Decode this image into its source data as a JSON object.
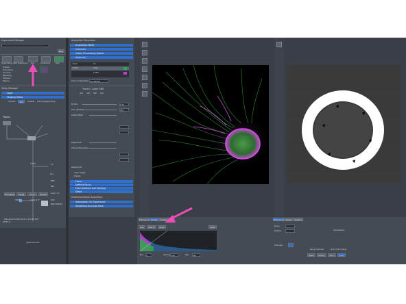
{
  "left_panel": {
    "experiment_manager": "Experiment Manager",
    "new_button": "New",
    "mode_tabs": [
      "Smart Setup",
      "Start Experiment",
      "Live",
      "Continuous",
      "Stop"
    ],
    "options": [
      "Z-Stack",
      "Time Series",
      "Tile Scan",
      "Bleaching",
      "Positions",
      "Regions"
    ],
    "setup_manager": "Setup Manager",
    "laser": "Laser",
    "imaging_setup": "Imaging Setup",
    "track_label": "Track1",
    "mode_options": [
      "Channel",
      "Fast",
      "Lambda",
      "Online Fingerprinting"
    ],
    "lightpath_labels": [
      "T PMT",
      "T1",
      "Ch1",
      "MBS",
      "488",
      "Lens 1.4x",
      "TPMT",
      "ChD",
      "MBS 488/561",
      "Angle 0.0°",
      "Plan-Apochromat 63x/1.4 Oil DIC M27",
      "Aperture 0 Ch1"
    ],
    "lightpath_buttons": [
      "Emulation",
      "Stage",
      "Fluor",
      "Transm"
    ],
    "bottom_label": "Off 25 %"
  },
  "acq_panel": {
    "title": "Acquisition Parameter",
    "sections": [
      "Acquisition Mode",
      "Channels",
      "Online Processing Options",
      "Channels"
    ],
    "track_table_headers": [
      "Track",
      "Ch"
    ],
    "track_rows": [
      "Track1",
      "ChS1",
      "T PMT"
    ],
    "track_config": "Track Configuration",
    "track_config_value": "not defined",
    "laser_title": "Track1 / Laser 488",
    "laser_lines": [
      "405",
      "458",
      "488",
      "514"
    ],
    "rows": [
      "Pinhole",
      "Gain (Master)",
      "Digital Offset",
      "Digital Gain",
      "Channel Resolution",
      "Wavelength"
    ],
    "value_a": "1.25",
    "value_b": "750",
    "bottom_sections": [
      "Focus",
      "Definite Focus",
      "Focus Devices and Strategy",
      "Stage",
      "Multidimensional Acquisition",
      "Information On Experiment",
      "Streaming and Auto Save"
    ],
    "checkbox_items": [
      "Laser Trigger",
      "Display"
    ]
  },
  "viewer": {
    "bottom_tabs": [
      "Dimensions",
      "Display",
      "Graphics"
    ],
    "histogram_labels": [
      "Auto",
      "Best Fit",
      "Reset"
    ],
    "min_label": "Min",
    "min_value": "0",
    "gamma_label": "Gamma",
    "gamma_value": "1.00",
    "max_label": "Max",
    "max_value": "255",
    "reset_label": "Reset"
  },
  "right_panel": {
    "tabs": [
      "Dimensions",
      "Display",
      "Graphics"
    ],
    "controls": [
      "Zoom",
      "Position",
      "Channels",
      "Interpolation"
    ],
    "buttons": [
      "Range Indicator",
      "Quick Color Setup",
      "Reset",
      "Extract",
      "Mono",
      "Color"
    ]
  },
  "colors": {
    "panel": "#454b54",
    "accent_blue": "#2f6fd0",
    "annotation_arrow": "#e94fb6",
    "histogram_green": "#2ea84a",
    "histogram_magenta": "#c33ad0"
  }
}
